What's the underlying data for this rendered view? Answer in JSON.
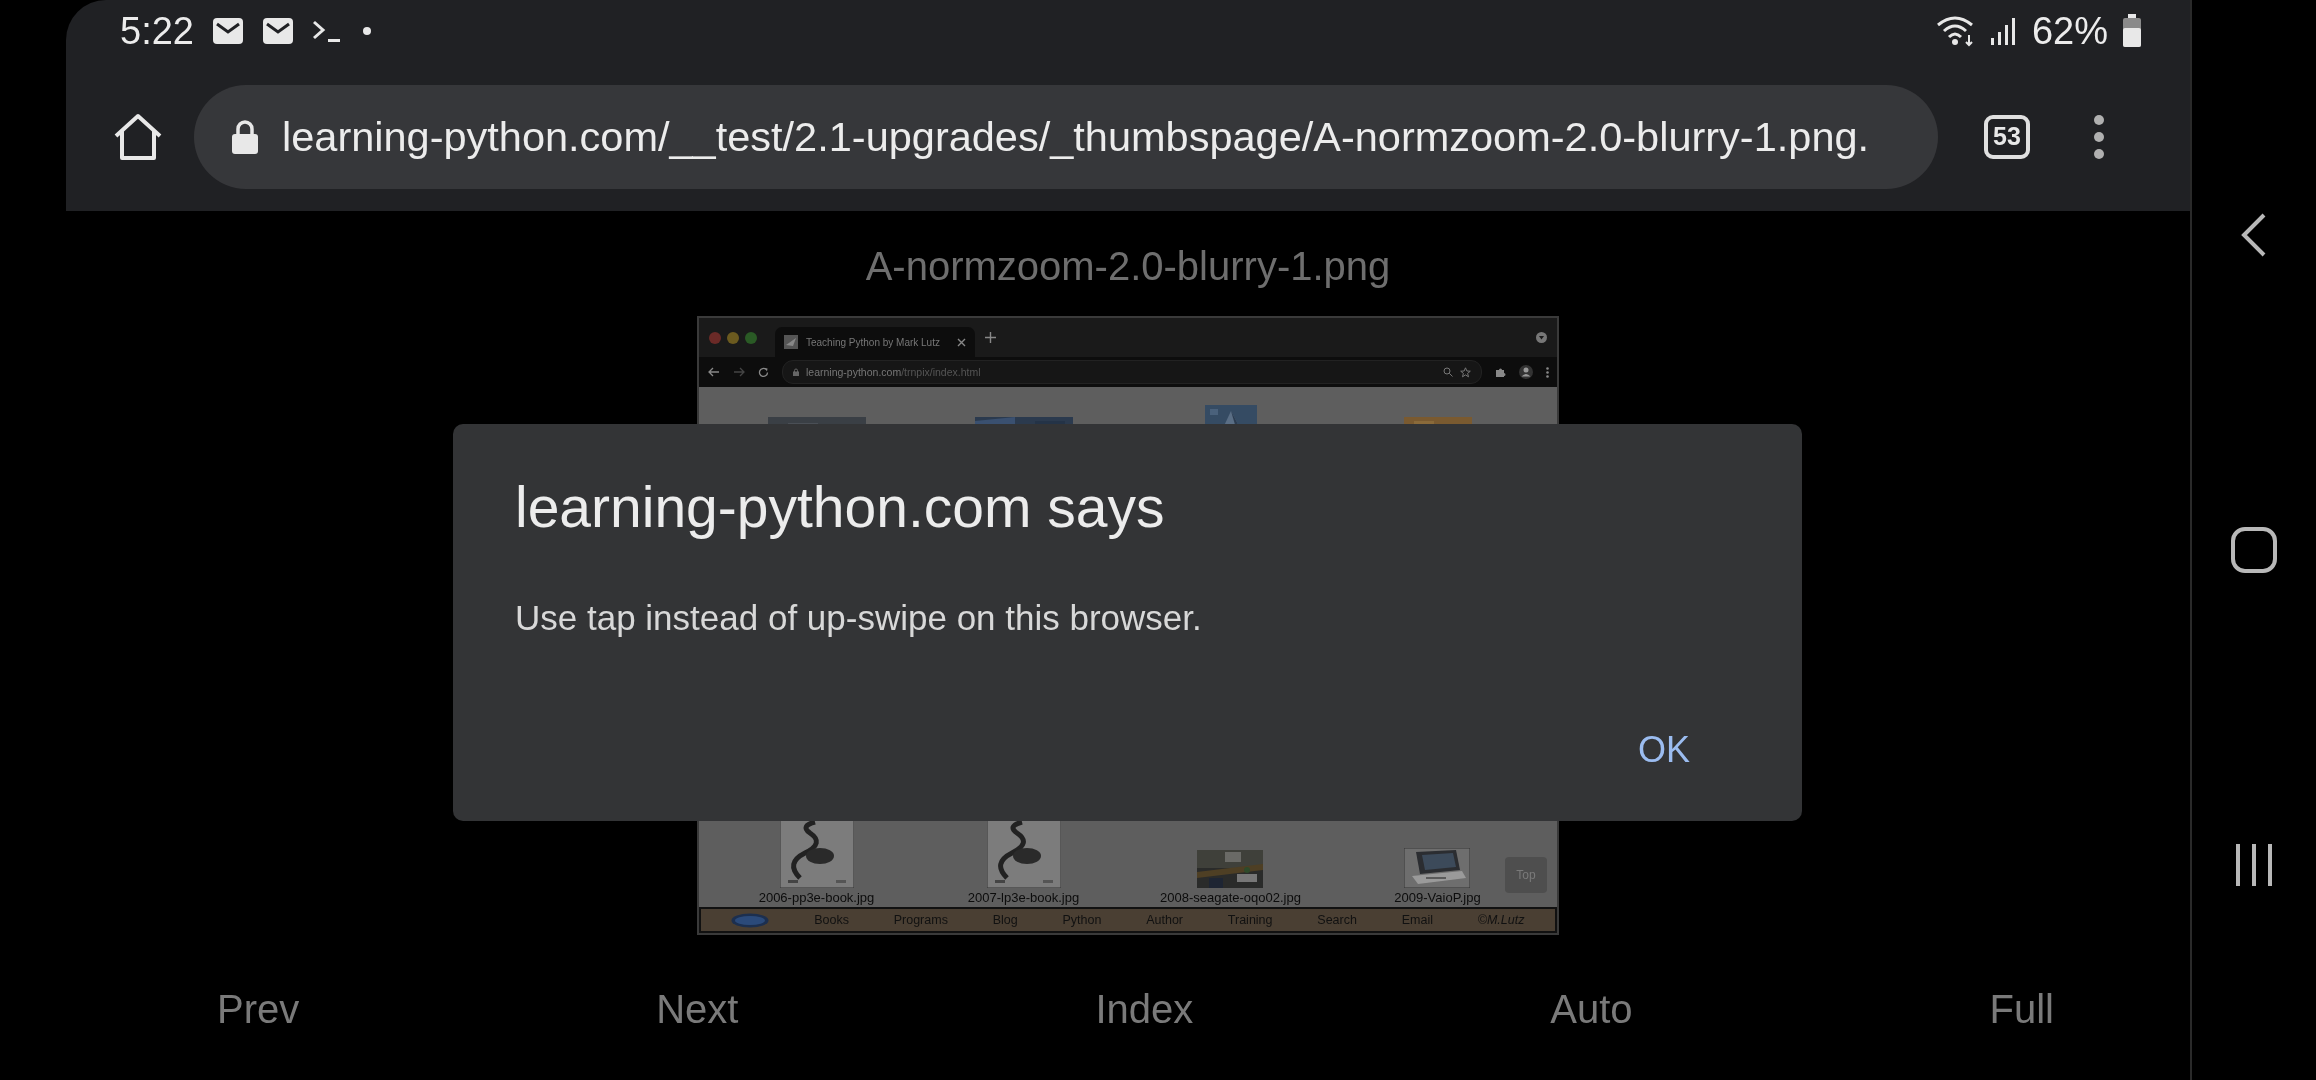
{
  "status_bar": {
    "time": "5:22",
    "battery": "62%"
  },
  "toolbar": {
    "url": "learning-python.com/__test/2.1-upgrades/_thumbspage/A-normzoom-2.0-blurry-1.png.",
    "tab_count": "53"
  },
  "image_title": "A-normzoom-2.0-blurry-1.png",
  "screenshot": {
    "tab_title": "Teaching Python by Mark Lutz",
    "url_host": "learning-python.com",
    "url_path": "/trnpix/index.html",
    "thumbnails": [
      {
        "kind": "book",
        "caption": "2006-pp3e-book.jpg"
      },
      {
        "kind": "book",
        "caption": "2007-lp3e-book.jpg"
      },
      {
        "caption": "2008-seagate-oqo02.jpg"
      },
      {
        "kind": "laptop",
        "caption": "2009-VaioP.jpg"
      }
    ],
    "top_button": "Top",
    "nav": [
      "Books",
      "Programs",
      "Blog",
      "Python",
      "Author",
      "Training",
      "Search",
      "Email",
      "©M.Lutz"
    ]
  },
  "dialog": {
    "title": "learning-python.com says",
    "message": "Use tap instead of up-swipe on this browser.",
    "button": "OK"
  },
  "bottom_nav": [
    "Prev",
    "Next",
    "Index",
    "Auto",
    "Full"
  ]
}
